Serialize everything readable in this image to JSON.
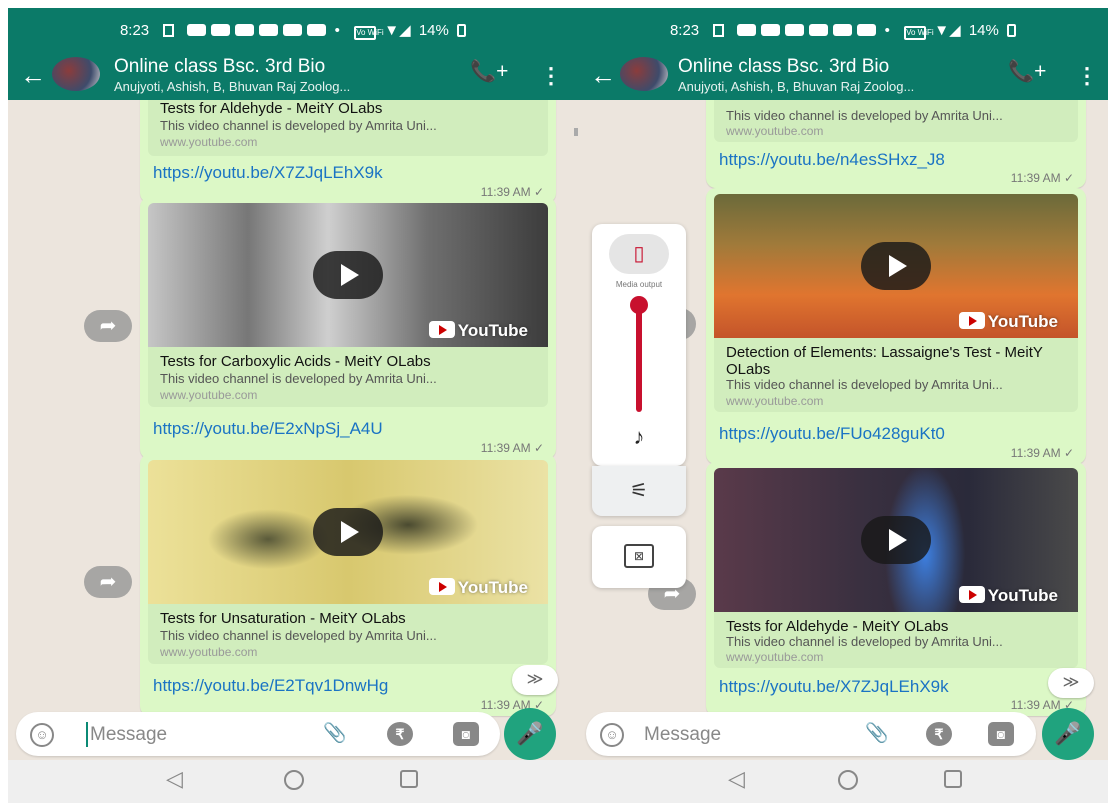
{
  "left": {
    "status": {
      "time": "8:23",
      "battery": "14%",
      "wifi_label": "Vo WiFi"
    },
    "header": {
      "title": "Online class Bsc. 3rd Bio",
      "subtitle": "Anujyoti, Ashish, B, Bhuvan Raj Zoolog..."
    },
    "messages": [
      {
        "title": "Tests for Aldehyde - MeitY OLabs",
        "desc": "This video channel is developed by Amrita Uni...",
        "domain": "www.youtube.com",
        "link": "https://youtu.be/X7ZJqLEhX9k",
        "time": "11:39 AM ✓"
      },
      {
        "title": "Tests for Carboxylic Acids - MeitY OLabs",
        "desc": "This video channel is developed by Amrita Uni...",
        "domain": "www.youtube.com",
        "link": "https://youtu.be/E2xNpSj_A4U",
        "time": "11:39 AM ✓",
        "yt": "YouTube"
      },
      {
        "title": "Tests for Unsaturation - MeitY OLabs",
        "desc": "This video channel is developed by Amrita Uni...",
        "domain": "www.youtube.com",
        "link": "https://youtu.be/E2Tqv1DnwHg",
        "time": "11:39 AM ✓",
        "yt": "YouTube"
      }
    ],
    "input_placeholder": "Message"
  },
  "right": {
    "status": {
      "time": "8:23",
      "battery": "14%",
      "wifi_label": "Vo WiFi"
    },
    "header": {
      "title": "Online class Bsc. 3rd Bio",
      "subtitle": "Anujyoti, Ashish, B, Bhuvan Raj Zoolog..."
    },
    "messages": [
      {
        "desc": "This video channel is developed by Amrita Uni...",
        "domain": "www.youtube.com",
        "link": "https://youtu.be/n4esSHxz_J8",
        "time": "11:39 AM ✓"
      },
      {
        "title": "Detection of Elements: Lassaigne's Test - MeitY OLabs",
        "desc": "This video channel is developed by Amrita Uni...",
        "domain": "www.youtube.com",
        "link": "https://youtu.be/FUo428guKt0",
        "time": "11:39 AM ✓",
        "yt": "YouTube"
      },
      {
        "title": "Tests for Aldehyde - MeitY OLabs",
        "desc": "This video channel is developed by Amrita Uni...",
        "domain": "www.youtube.com",
        "link": "https://youtu.be/X7ZJqLEhX9k",
        "time": "11:39 AM ✓",
        "yt": "YouTube"
      }
    ],
    "input_placeholder": "Message",
    "volume_panel": {
      "media_output_label": "Media output",
      "level": 1.0
    }
  },
  "icons": {
    "back": "←",
    "add_call": "📞+",
    "menu": "⋮",
    "forward": "➦",
    "scroll_down": "≫",
    "emoji": "☺",
    "attach": "📎",
    "rupee": "₹",
    "camera": "◙",
    "mic": "🎤",
    "nav_back": "◁",
    "music_note": "♪",
    "equalizer": "⚟",
    "cast": "⊠"
  },
  "colors": {
    "header": "#0b7a68",
    "bubble": "#dcf8c6",
    "link": "#1a73c4",
    "mic": "#20a37e",
    "volume": "#c8102e"
  }
}
